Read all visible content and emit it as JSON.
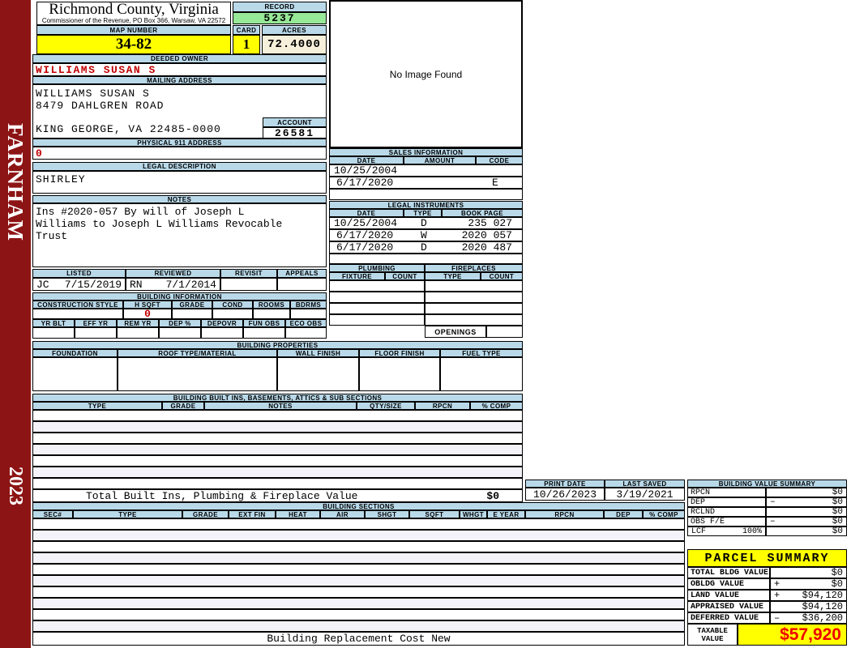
{
  "page": {
    "district": "FARNHAM",
    "year": "2023",
    "bottom_caption": "Building Replacement Cost New"
  },
  "colors": {
    "sidebar_maroon": "#8c1414",
    "header_blue": "#b9d9e9",
    "highlight_yellow": "#ffff00",
    "record_green": "#97e897",
    "acres_cream": "#f6f0da",
    "alert_red": "#c00000",
    "taxable_red": "#ee0000"
  },
  "header": {
    "county": "Richmond County, Virginia",
    "address": "Commissioner of the Revenue, PO Box 366, Warsaw, VA 22572",
    "record_label": "RECORD",
    "record_value": "5237",
    "map_number_label": "MAP NUMBER",
    "map_number": "34-82",
    "card_label": "CARD",
    "card": "1",
    "acres_label": "ACRES",
    "acres": "72.4000"
  },
  "owner": {
    "deeded_owner_label": "DEEDED OWNER",
    "deeded_owner": "WILLIAMS SUSAN S",
    "mailing_address_label": "MAILING ADDRESS",
    "mailing_lines": [
      "WILLIAMS SUSAN S",
      "8479 DAHLGREN ROAD",
      "",
      "KING GEORGE, VA 22485-0000"
    ],
    "account_label": "ACCOUNT",
    "account": "26581",
    "physical_address_label": "PHYSICAL 911 ADDRESS",
    "physical_address": "0",
    "legal_description_label": "LEGAL DESCRIPTION",
    "legal_description": "SHIRLEY",
    "notes_label": "NOTES",
    "notes_lines": [
      "Ins #2020-057 By will of Joseph L",
      "Williams to Joseph L Williams Revocable",
      "Trust"
    ]
  },
  "review": {
    "headers": [
      "LISTED",
      "REVIEWED",
      "REVISIT",
      "APPEALS"
    ],
    "listed_by": "JC",
    "listed_date": "7/15/2019",
    "reviewed_by": "RN",
    "reviewed_date": "7/1/2014",
    "revisit": "",
    "appeals": ""
  },
  "photo": {
    "placeholder": "No Image Found"
  },
  "sales": {
    "title": "SALES INFORMATION",
    "headers": [
      "DATE",
      "AMOUNT",
      "CODE"
    ],
    "rows": [
      {
        "date": "10/25/2004",
        "amount": "",
        "code": ""
      },
      {
        "date": "6/17/2020",
        "amount": "",
        "code": "E"
      }
    ]
  },
  "legal_instruments": {
    "title": "LEGAL INSTRUMENTS",
    "headers": [
      "DATE",
      "TYPE",
      "BOOK PAGE"
    ],
    "rows": [
      {
        "date": "10/25/2004",
        "type": "D",
        "book_page": "235 027"
      },
      {
        "date": "6/17/2020",
        "type": "W",
        "book_page": "2020 057"
      },
      {
        "date": "6/17/2020",
        "type": "D",
        "book_page": "2020 487"
      }
    ]
  },
  "plumbing": {
    "title": "PLUMBING",
    "headers": [
      "FIXTURE",
      "COUNT"
    ]
  },
  "fireplaces": {
    "title": "FIREPLACES",
    "headers": [
      "TYPE",
      "COUNT"
    ],
    "openings_label": "OPENINGS"
  },
  "building_information": {
    "title": "BUILDING INFORMATION",
    "row1_headers": [
      "CONSTRUCTION STYLE",
      "H SQFT",
      "GRADE",
      "COND",
      "ROOMS",
      "BDRMS"
    ],
    "h_sqft": "0",
    "row2_headers": [
      "YR BLT",
      "EFF YR",
      "REM YR",
      "DEP %",
      "DEPOVR",
      "FUN OBS",
      "ECO OBS"
    ]
  },
  "building_properties": {
    "title": "BUILDING PROPERTIES",
    "headers": [
      "FOUNDATION",
      "ROOF TYPE/MATERIAL",
      "WALL FINISH",
      "FLOOR FINISH",
      "FUEL TYPE"
    ]
  },
  "built_ins": {
    "title": "BUILDING BUILT INS, BASEMENTS, ATTICS & SUB SECTIONS",
    "headers": [
      "TYPE",
      "GRADE",
      "NOTES",
      "QTY/SIZE",
      "RPCN",
      "% COMP"
    ],
    "total_label": "Total Built Ins, Plumbing & Fireplace Value",
    "total_value": "$0"
  },
  "building_sections": {
    "title": "BUILDING SECTIONS",
    "headers": [
      "SEC#",
      "TYPE",
      "GRADE",
      "EXT FIN",
      "HEAT",
      "AIR",
      "SHGT",
      "SQFT",
      "WHGT",
      "E YEAR",
      "RPCN",
      "DEP",
      "% COMP"
    ]
  },
  "print_info": {
    "print_date_label": "PRINT DATE",
    "print_date": "10/26/2023",
    "last_saved_label": "LAST SAVED",
    "last_saved": "3/19/2021"
  },
  "building_value_summary": {
    "title": "BUILDING VALUE SUMMARY",
    "rows": [
      {
        "label": "RPCN",
        "op": "",
        "value": "$0"
      },
      {
        "label": "DEP",
        "op": "–",
        "value": "$0"
      },
      {
        "label": "RCLND",
        "op": "",
        "value": "$0"
      },
      {
        "label": "OBS F/E",
        "op": "–",
        "value": "$0"
      },
      {
        "label": "LCF",
        "pct": "100%",
        "op": "",
        "value": "$0"
      }
    ]
  },
  "parcel_summary": {
    "title": "PARCEL SUMMARY",
    "rows": [
      {
        "label": "TOTAL BLDG VALUE",
        "op": "",
        "value": "$0"
      },
      {
        "label": "OBLDG VALUE",
        "op": "+",
        "value": "$0"
      },
      {
        "label": "LAND VALUE",
        "op": "+",
        "value": "$94,120"
      },
      {
        "label": "APPRAISED VALUE",
        "op": "",
        "value": "$94,120"
      },
      {
        "label": "DEFERRED VALUE",
        "op": "–",
        "value": "$36,200"
      }
    ],
    "taxable_label": "TAXABLE VALUE",
    "taxable_value": "$57,920"
  }
}
